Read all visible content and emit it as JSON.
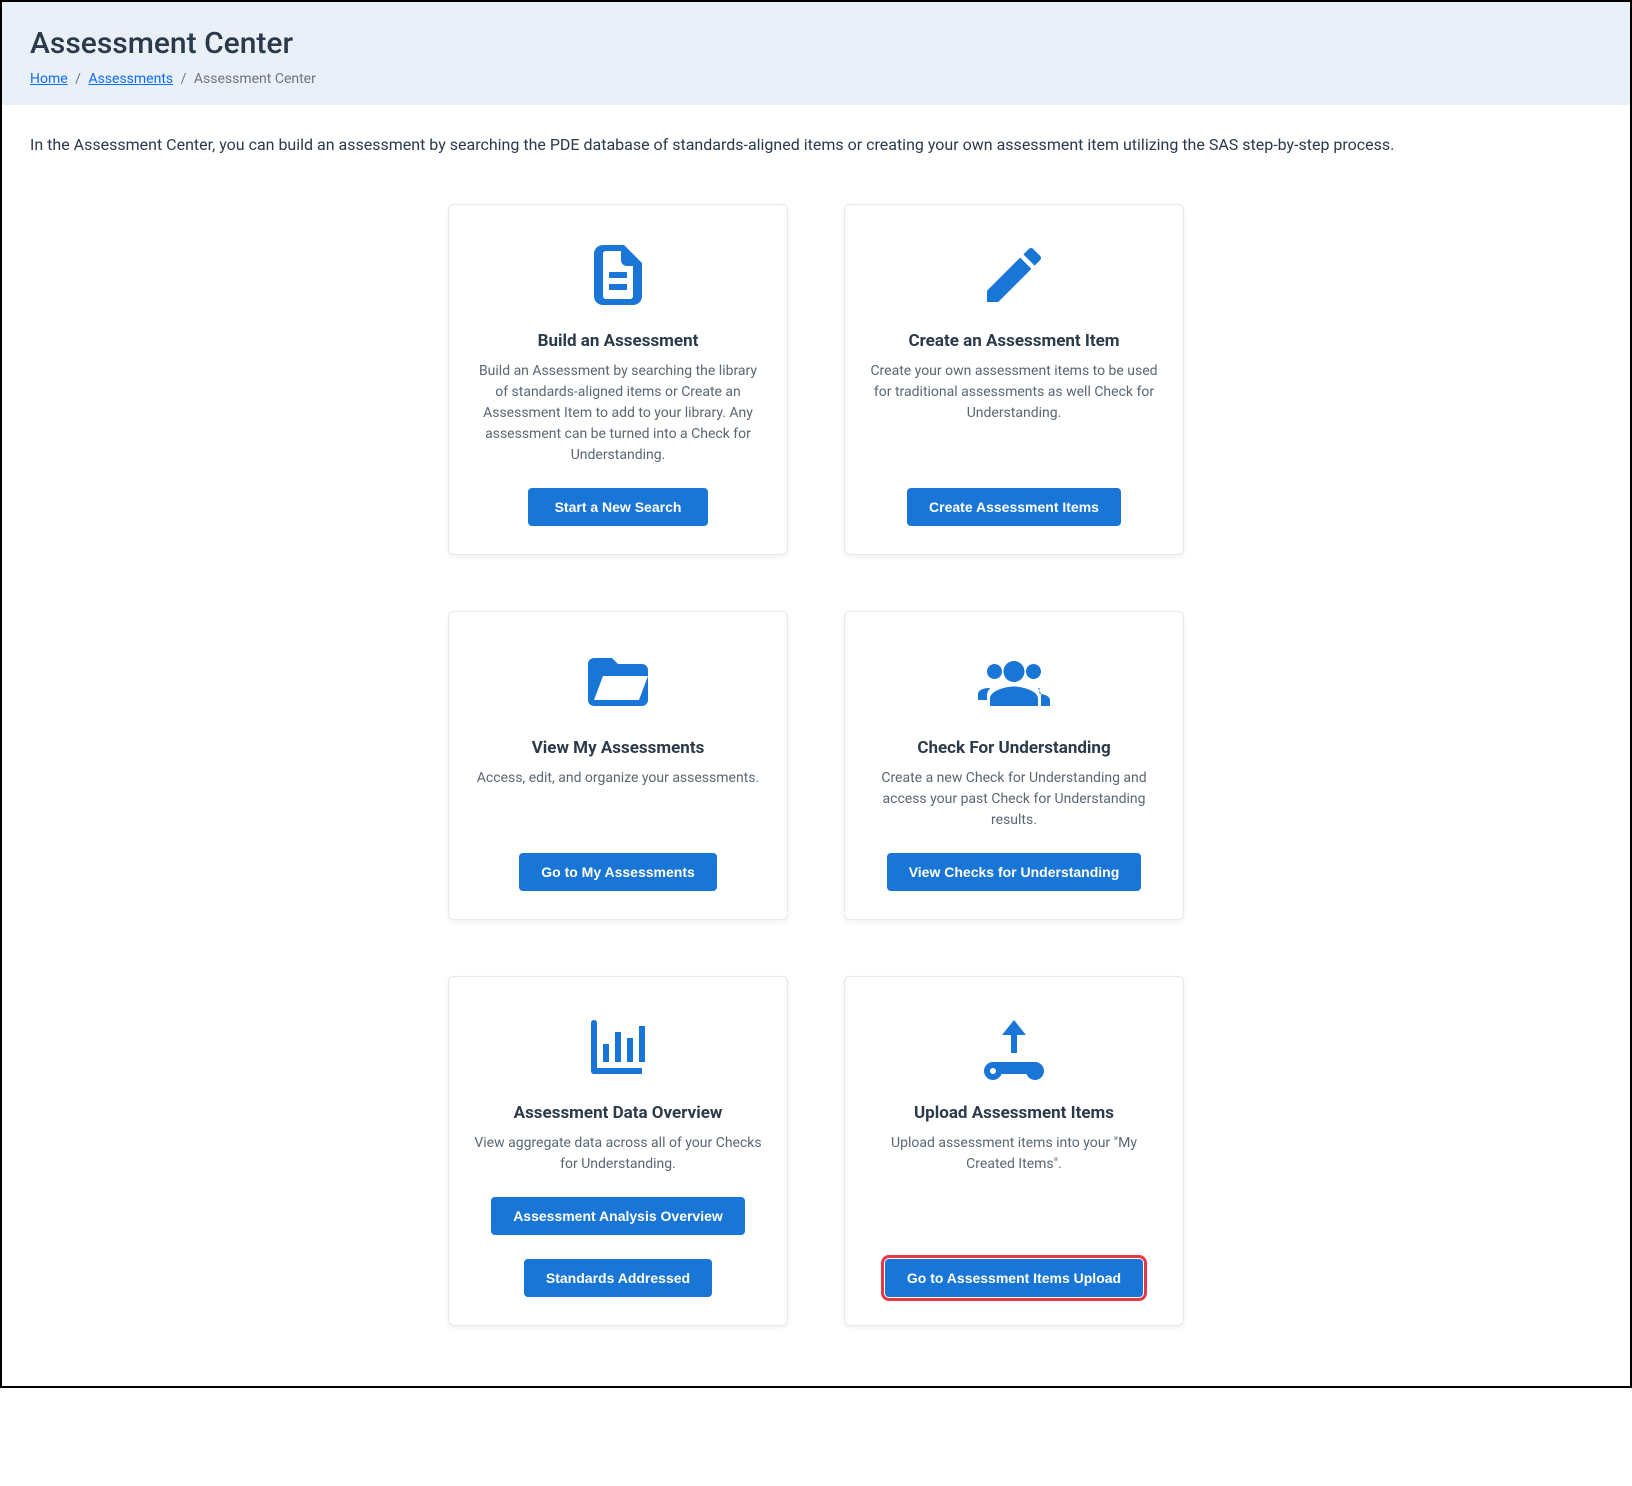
{
  "header": {
    "title": "Assessment Center"
  },
  "breadcrumb": {
    "home": "Home",
    "assessments": "Assessments",
    "current": "Assessment Center"
  },
  "intro": "In the Assessment Center, you can build an assessment by searching the PDE database of standards-aligned items or creating your own assessment item utilizing the SAS step-by-step process.",
  "cards": {
    "build": {
      "title": "Build an Assessment",
      "desc": "Build an Assessment by searching the library of standards-aligned items or Create an Assessment Item to add to your library. Any assessment can be turned into a Check for Understanding.",
      "button": "Start a New Search"
    },
    "create": {
      "title": "Create an Assessment Item",
      "desc": "Create your own assessment items to be used for traditional assessments as well Check for Understanding.",
      "button": "Create Assessment Items"
    },
    "view": {
      "title": "View My Assessments",
      "desc": "Access, edit, and organize your assessments.",
      "button": "Go to My Assessments"
    },
    "cfu": {
      "title": "Check For Understanding",
      "desc": "Create a new Check for Understanding and access your past Check for Understanding results.",
      "button": "View Checks for Understanding"
    },
    "data": {
      "title": "Assessment Data Overview",
      "desc": "View aggregate data across all of your Checks for Understanding.",
      "button1": "Assessment Analysis Overview",
      "button2": "Standards Addressed"
    },
    "upload": {
      "title": "Upload Assessment Items",
      "desc": "Upload assessment items into your \"My Created Items\".",
      "button": "Go to Assessment Items Upload"
    }
  }
}
